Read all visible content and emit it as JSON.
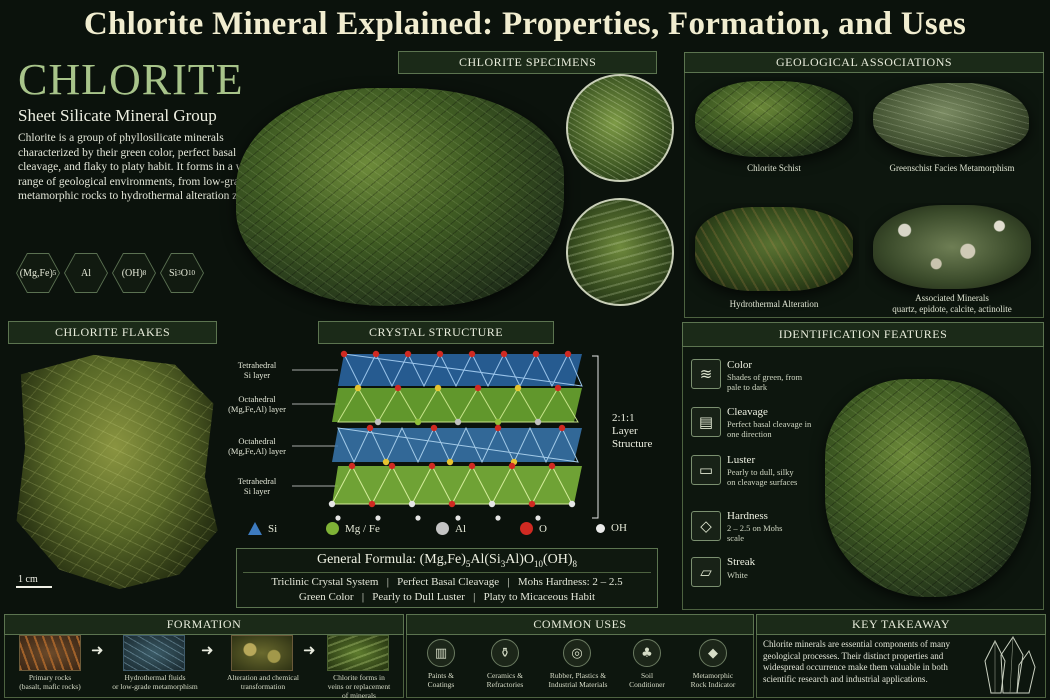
{
  "title": "Chlorite Mineral Explained: Properties, Formation, and Uses",
  "intro": {
    "heading": "CHLORITE",
    "subheading": "Sheet Silicate Mineral Group",
    "description": "Chlorite is a group of phyllosilicate minerals characterized by their green color, perfect basal cleavage, and flaky to platy habit. It forms in a wide range of geological environments, from low-grade metamorphic rocks to hydrothermal alteration zones.",
    "hexes": [
      "(Mg,Fe)",
      "Al",
      "(OH)",
      "Si"
    ],
    "hex_subs": [
      "5",
      "",
      "8",
      "3"
    ],
    "hex_suffix": [
      "",
      "",
      "",
      "O"
    ],
    "hex_suffix_sub": [
      "",
      "",
      "",
      "10"
    ]
  },
  "specimens": {
    "title": "CHLORITE SPECIMENS"
  },
  "geological": {
    "title": "GEOLOGICAL ASSOCIATIONS",
    "items": [
      {
        "caption": "Chlorite Schist"
      },
      {
        "caption": "Greenschist Facies Metamorphism"
      },
      {
        "caption": "Hydrothermal Alteration"
      },
      {
        "caption": "Associated Minerals",
        "caption2": "quartz, epidote, calcite, actinolite"
      }
    ]
  },
  "flakes": {
    "title": "CHLORITE FLAKES",
    "scale": "1 cm"
  },
  "structure": {
    "title": "CRYSTAL STRUCTURE",
    "layers": [
      {
        "line1": "Tetrahedral",
        "line2": "Si layer"
      },
      {
        "line1": "Octahedral",
        "line2": "(Mg,Fe,Al) layer"
      },
      {
        "line1": "Octahedral",
        "line2": "(Mg,Fe,Al) layer"
      },
      {
        "line1": "Tetrahedral",
        "line2": "Si layer"
      }
    ],
    "side_label": [
      "2:1:1",
      "Layer",
      "Structure"
    ],
    "legend": [
      "Si",
      "Mg / Fe",
      "Al",
      "O",
      "OH"
    ],
    "formula_label": "General Formula:",
    "formula_parts": [
      "(Mg,Fe)",
      "5",
      "Al(Si",
      "3",
      "Al)O",
      "10",
      "(OH)",
      "8"
    ],
    "props_line1": "Triclinic Crystal System   |   Perfect Basal Cleavage   |   Mohs Hardness: 2 – 2.5",
    "props_line2": "Green Color   |   Pearly to Dull Luster   |   Platy to Micaceous Habit"
  },
  "identification": {
    "title": "IDENTIFICATION FEATURES",
    "items": [
      {
        "name": "Color",
        "desc": "Shades of green, from pale to dark",
        "icon": "layers-icon",
        "glyph": "≋"
      },
      {
        "name": "Cleavage",
        "desc": "Perfect basal cleavage in one direction",
        "icon": "cleavage-icon",
        "glyph": "▤"
      },
      {
        "name": "Luster",
        "desc": "Pearly to dull, silky on cleavage surfaces",
        "icon": "luster-icon",
        "glyph": "▭"
      },
      {
        "name": "Hardness",
        "desc": "2 – 2.5 on Mohs scale",
        "icon": "diamond-icon",
        "glyph": "◇"
      },
      {
        "name": "Streak",
        "desc": "White",
        "icon": "streak-icon",
        "glyph": "▱"
      }
    ]
  },
  "formation": {
    "title": "FORMATION",
    "steps": [
      {
        "line1": "Primary rocks",
        "line2": "(basalt, mafic rocks)"
      },
      {
        "line1": "Hydrothermal fluids",
        "line2": "or low-grade metamorphism"
      },
      {
        "line1": "Alteration and chemical",
        "line2": "transformation"
      },
      {
        "line1": "Chlorite forms in",
        "line2": "veins or replacement",
        "line3": "of minerals"
      }
    ]
  },
  "uses": {
    "title": "COMMON USES",
    "items": [
      {
        "line1": "Paints &",
        "line2": "Coatings",
        "icon": "paint-can-icon",
        "glyph": "▥"
      },
      {
        "line1": "Ceramics &",
        "line2": "Refractories",
        "icon": "vase-icon",
        "glyph": "⚱"
      },
      {
        "line1": "Rubber, Plastics &",
        "line2": "Industrial Materials",
        "icon": "roll-icon",
        "glyph": "◎"
      },
      {
        "line1": "Soil",
        "line2": "Conditioner",
        "icon": "sprout-icon",
        "glyph": "♣"
      },
      {
        "line1": "Metamorphic",
        "line2": "Rock Indicator",
        "icon": "rock-icon",
        "glyph": "◆"
      }
    ]
  },
  "takeaway": {
    "title": "KEY TAKEAWAY",
    "text": "Chlorite minerals are essential components of many geological processes. Their distinct properties and widespread occurrence make them valuable in both scientific research and industrial applications."
  }
}
